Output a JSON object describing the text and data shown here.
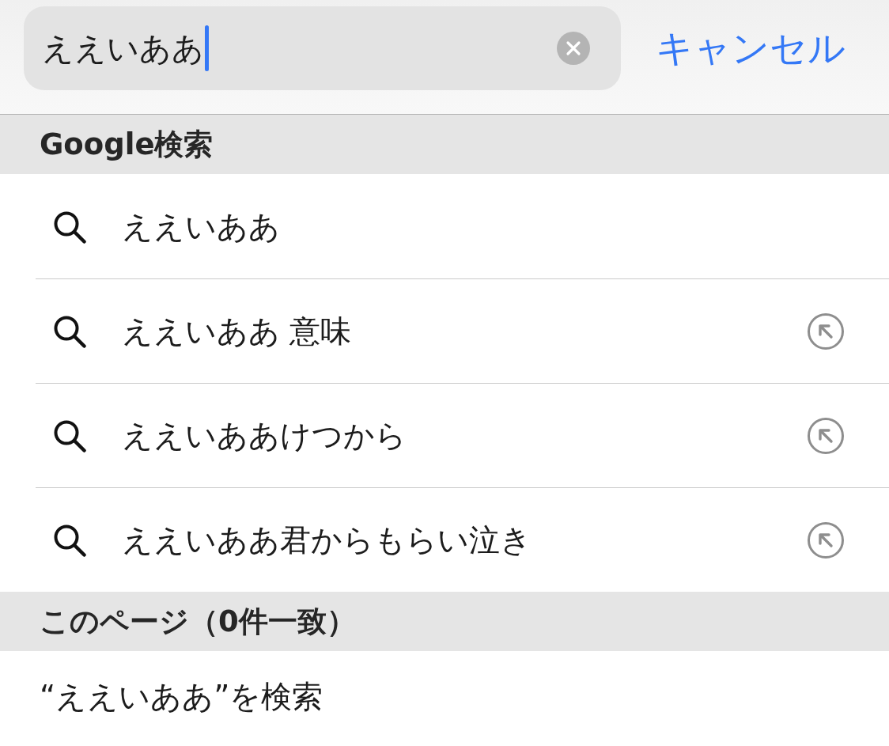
{
  "search_bar": {
    "field": {
      "value": "ええいああ",
      "focused": true
    },
    "cancel": "キャンセル"
  },
  "sections": [
    {
      "title": "Google検索",
      "kind": "suggestions",
      "items": [
        {
          "text": "ええいああ",
          "fill_arrow": false
        },
        {
          "text": "ええいああ 意味",
          "fill_arrow": true
        },
        {
          "text": "ええいああけつから",
          "fill_arrow": true
        },
        {
          "text": "ええいああ君からもらい泣き",
          "fill_arrow": true
        }
      ]
    },
    {
      "title": "このページ（0件一致）",
      "kind": "find",
      "items": [
        {
          "text": "“ええいああ”を検索"
        }
      ]
    }
  ]
}
